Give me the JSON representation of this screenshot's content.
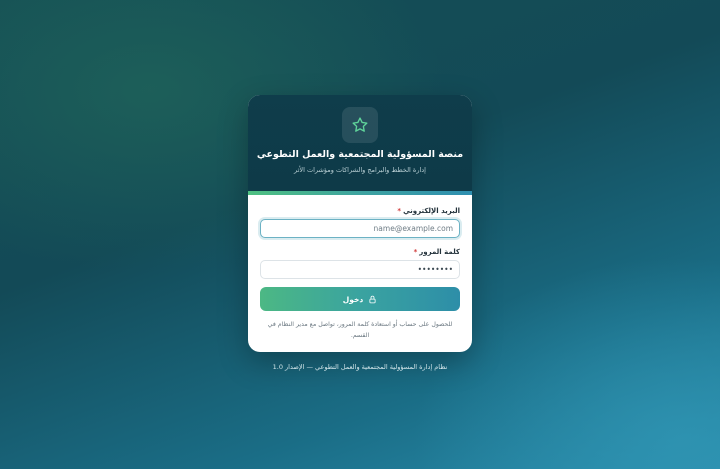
{
  "header": {
    "logo_icon": "star-icon",
    "title": "منصة المسؤولية المجتمعية والعمل التطوعي",
    "subtitle": "إدارة الخطط والبرامج والشراكات ومؤشرات الأثر"
  },
  "form": {
    "email_label": "البريد الإلكتروني",
    "email_placeholder": "name@example.com",
    "password_label": "كلمة المرور",
    "password_value": "12345678",
    "required_mark": "*",
    "submit_label": "دخول",
    "submit_icon": "lock-icon",
    "help_text": "للحصول على حساب أو استعادة كلمة المرور، تواصل مع مدير النظام في القسم."
  },
  "footer": {
    "text": "نظام إدارة المسؤولية المجتمعية والعمل التطوعي — الإصدار 1.0"
  },
  "colors": {
    "header_bg": "#0f3d4b",
    "accent_green": "#4cb884",
    "accent_blue": "#2d8ea8",
    "required": "#d23c3c"
  }
}
